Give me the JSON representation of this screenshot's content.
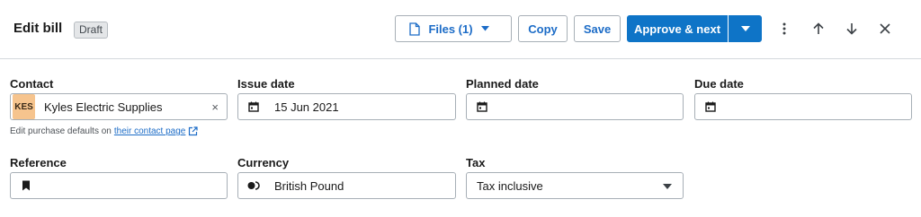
{
  "header": {
    "title": "Edit bill",
    "status_badge": "Draft",
    "files_label": "Files (1)",
    "copy_label": "Copy",
    "save_label": "Save",
    "approve_label": "Approve & next"
  },
  "form": {
    "contact": {
      "label": "Contact",
      "avatar_initials": "KES",
      "value": "Kyles Electric Supplies",
      "clear_symbol": "×"
    },
    "helper": {
      "text": "Edit purchase defaults on",
      "link_text": "their contact page"
    },
    "issue_date": {
      "label": "Issue date",
      "value": "15 Jun 2021"
    },
    "planned_date": {
      "label": "Planned date",
      "value": ""
    },
    "due_date": {
      "label": "Due date",
      "value": ""
    },
    "reference": {
      "label": "Reference",
      "value": ""
    },
    "currency": {
      "label": "Currency",
      "value": "British Pound"
    },
    "tax": {
      "label": "Tax",
      "value": "Tax inclusive"
    }
  },
  "colors": {
    "primary": "#0e74c7",
    "link": "#1c6cc7",
    "border": "#a7afb6",
    "avatar_bg": "#f6c48e"
  }
}
